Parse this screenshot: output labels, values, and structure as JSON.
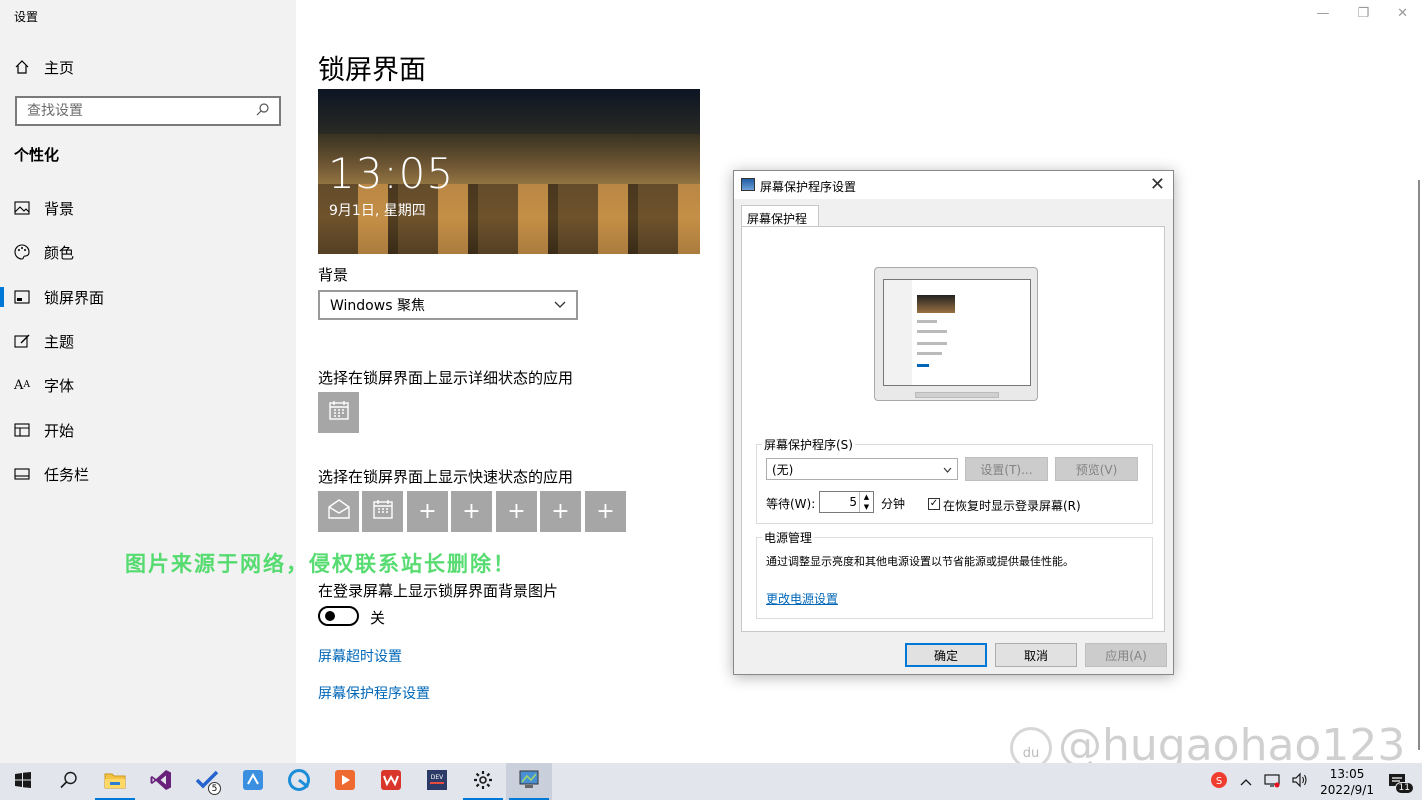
{
  "window": {
    "title": "设置",
    "controls": [
      "minimize-icon",
      "restore-icon",
      "close-icon"
    ]
  },
  "sidebar": {
    "home_label": "主页",
    "search_placeholder": "查找设置",
    "group_label": "个性化",
    "items": [
      {
        "label": "背景",
        "icon": "image-icon"
      },
      {
        "label": "颜色",
        "icon": "palette-icon"
      },
      {
        "label": "锁屏界面",
        "icon": "lockscreen-icon",
        "active": true
      },
      {
        "label": "主题",
        "icon": "theme-icon"
      },
      {
        "label": "字体",
        "icon": "font-icon"
      },
      {
        "label": "开始",
        "icon": "start-icon"
      },
      {
        "label": "任务栏",
        "icon": "taskbar-icon"
      }
    ]
  },
  "main": {
    "title": "锁屏界面",
    "preview": {
      "time": "13:05",
      "date": "9月1日, 星期四"
    },
    "background_label": "背景",
    "background_value": "Windows 聚焦",
    "detailed_status_label": "选择在锁屏界面上显示详细状态的应用",
    "quick_status_label": "选择在锁屏界面上显示快速状态的应用",
    "quick_status_tiles": [
      "mail-icon",
      "calendar-icon",
      "plus-icon",
      "plus-icon",
      "plus-icon",
      "plus-icon",
      "plus-icon"
    ],
    "signin_bg_label": "在登录屏幕上显示锁屏界面背景图片",
    "signin_bg_state": "关",
    "link_timeout": "屏幕超时设置",
    "link_screensaver": "屏幕保护程序设置",
    "watermark_cn": "图片来源于网络，侵权联系站长删除！",
    "watermark_en": "@hugaohao123"
  },
  "dialog": {
    "title": "屏幕保护程序设置",
    "tab": "屏幕保护程序",
    "screensaver_group": "屏幕保护程序(S)",
    "screensaver_value": "(无)",
    "settings_button": "设置(T)...",
    "preview_button": "预览(V)",
    "wait_label": "等待(W):",
    "wait_value": "5",
    "wait_unit": "分钟",
    "resume_label": "在恢复时显示登录屏幕(R)",
    "power_group": "电源管理",
    "power_text": "通过调整显示亮度和其他电源设置以节省能源或提供最佳性能。",
    "power_link": "更改电源设置",
    "ok": "确定",
    "cancel": "取消",
    "apply": "应用(A)"
  },
  "taskbar": {
    "apps": [
      {
        "name": "start-button",
        "icon": "windows-icon"
      },
      {
        "name": "search-button",
        "icon": "search-icon"
      },
      {
        "name": "file-explorer",
        "icon": "folder-icon",
        "running": true
      },
      {
        "name": "visual-studio",
        "icon": "visual-studio-icon"
      },
      {
        "name": "vs-code-tasks",
        "icon": "checkmark-app-icon",
        "badge": "5"
      },
      {
        "name": "app-blue",
        "icon": "bookmark-app-icon"
      },
      {
        "name": "app-browser",
        "icon": "browser-icon"
      },
      {
        "name": "app-orange",
        "icon": "media-app-icon"
      },
      {
        "name": "wps",
        "icon": "wps-icon"
      },
      {
        "name": "devexpress",
        "icon": "dev-icon"
      },
      {
        "name": "settings",
        "icon": "gear-icon",
        "running": true
      },
      {
        "name": "screensaver-dialog",
        "icon": "display-icon",
        "running": true,
        "active": true
      }
    ],
    "clock_time": "13:05",
    "clock_date": "2022/9/1",
    "notification_count": "11"
  }
}
